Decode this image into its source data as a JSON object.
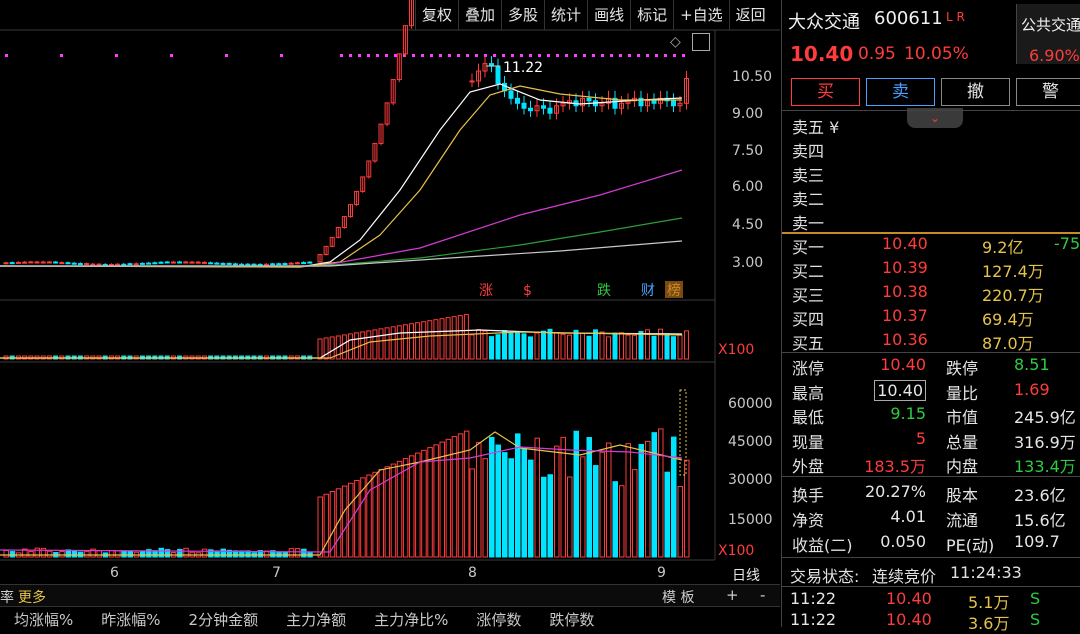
{
  "toolbar": {
    "items": [
      "复权",
      "叠加",
      "多股",
      "统计",
      "画线",
      "标记",
      "+自选",
      "返回"
    ]
  },
  "price_axis": {
    "labels": [
      "10.50",
      "9.00",
      "7.50",
      "6.00",
      "4.50",
      "3.00"
    ]
  },
  "vol_axis": {
    "scale": "X100"
  },
  "ind_axis": {
    "labels": [
      "60000",
      "45000",
      "30000",
      "15000"
    ],
    "scale": "X100"
  },
  "chart_labels": {
    "high_marker": "11.22",
    "markers": [
      "涨",
      "$",
      "跌",
      "财",
      "榜"
    ]
  },
  "x_ticks": [
    "6",
    "7",
    "8",
    "9"
  ],
  "bottom_bar": {
    "left_cut": "率",
    "more": "更多",
    "daily": "日线",
    "board": "模 板",
    "plus": "+",
    "minus": "-"
  },
  "columns": [
    "均涨幅%",
    "昨涨幅%",
    "2分钟金额",
    "主力净额",
    "主力净比%",
    "涨停数",
    "跌停数"
  ],
  "stock": {
    "name": "大众交通",
    "code": "600611",
    "flags": "L R",
    "price": "10.40",
    "change": "0.95",
    "change_pct": "10.05%",
    "sector_name": "公共交通",
    "sector_pct": "6.90%"
  },
  "buttons": [
    "买",
    "卖",
    "撤",
    "警"
  ],
  "sell_levels": [
    {
      "label": "卖五 ¥"
    },
    {
      "label": "卖四"
    },
    {
      "label": "卖三"
    },
    {
      "label": "卖二"
    },
    {
      "label": "卖一"
    }
  ],
  "buy_levels": [
    {
      "label": "买一",
      "price": "10.40",
      "vol": "9.2亿",
      "extra": "-75"
    },
    {
      "label": "买二",
      "price": "10.39",
      "vol": "127.4万",
      "extra": ""
    },
    {
      "label": "买三",
      "price": "10.38",
      "vol": "220.7万",
      "extra": ""
    },
    {
      "label": "买四",
      "price": "10.37",
      "vol": "69.4万",
      "extra": ""
    },
    {
      "label": "买五",
      "price": "10.36",
      "vol": "87.0万",
      "extra": ""
    }
  ],
  "stats": [
    {
      "l1": "涨停",
      "v1": "10.40",
      "l2": "跌停",
      "v2": "8.51"
    },
    {
      "l1": "最高",
      "v1": "10.40",
      "l2": "量比",
      "v2": "1.69"
    },
    {
      "l1": "最低",
      "v1": "9.15",
      "l2": "市值",
      "v2": "245.9亿"
    },
    {
      "l1": "现量",
      "v1": "5",
      "l2": "总量",
      "v2": "316.9万"
    },
    {
      "l1": "外盘",
      "v1": "183.5万",
      "l2": "内盘",
      "v2": "133.4万"
    }
  ],
  "fund": [
    {
      "l1": "换手",
      "v1": "20.27%",
      "l2": "股本",
      "v2": "23.6亿"
    },
    {
      "l1": "净资",
      "v1": "4.01",
      "l2": "流通",
      "v2": "15.6亿"
    },
    {
      "l1": "收益(二)",
      "v1": "0.050",
      "l2": "PE(动)",
      "v2": "109.7"
    }
  ],
  "trade_status": {
    "label": "交易状态:",
    "value": "连续竞价",
    "time": "11:24:33"
  },
  "ticks": [
    {
      "time": "11:22",
      "price": "10.40",
      "vol": "5.1万",
      "side": "S"
    },
    {
      "time": "11:22",
      "price": "10.40",
      "vol": "3.6万",
      "side": "S"
    }
  ],
  "colors": {
    "up": "#ff3c3c",
    "down": "#00e5ff",
    "ma5": "#ffffff",
    "ma10": "#e6c34a",
    "ma20": "#d43cd4",
    "ma60": "#2e9e3a",
    "ma120": "#c8c8c8",
    "vol_line": "#ffffff"
  }
}
